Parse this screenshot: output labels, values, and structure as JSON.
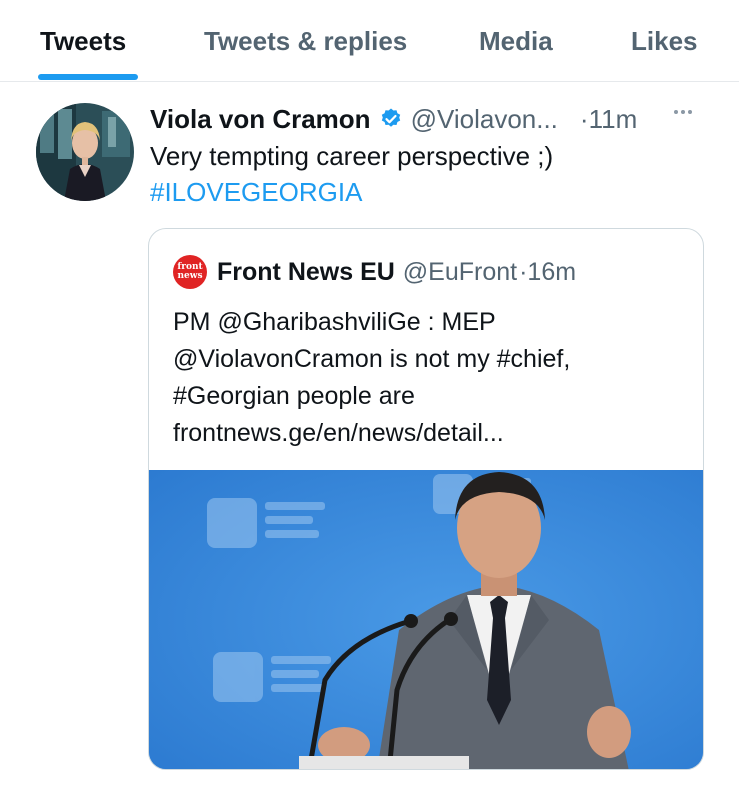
{
  "tabs": [
    {
      "label": "Tweets",
      "active": true
    },
    {
      "label": "Tweets & replies",
      "active": false
    },
    {
      "label": "Media",
      "active": false
    },
    {
      "label": "Likes",
      "active": false
    }
  ],
  "tweet": {
    "author_name": "Viola von Cramon",
    "handle": "@Violavon...",
    "time": "·11m",
    "text": "Very tempting career perspective ;)",
    "hashtag": "#ILOVEGEORGIA"
  },
  "quote": {
    "logo_text": [
      "front",
      "news"
    ],
    "author_name": "Front News EU",
    "handle": "@EuFront",
    "time": "·16m",
    "lines": [
      "PM @GharibashviliGe : MEP",
      "@ViolavonCramon is not my #chief,",
      "#Georgian people are",
      "frontnews.ge/en/news/detail..."
    ]
  },
  "colors": {
    "accent": "#1d9bf0",
    "text_primary": "#0f1419",
    "text_secondary": "#536471",
    "border": "#cfd9de",
    "logo_red": "#e02424"
  },
  "icons": {
    "verified": "verified-badge-icon",
    "more": "more-horizontal-icon"
  }
}
